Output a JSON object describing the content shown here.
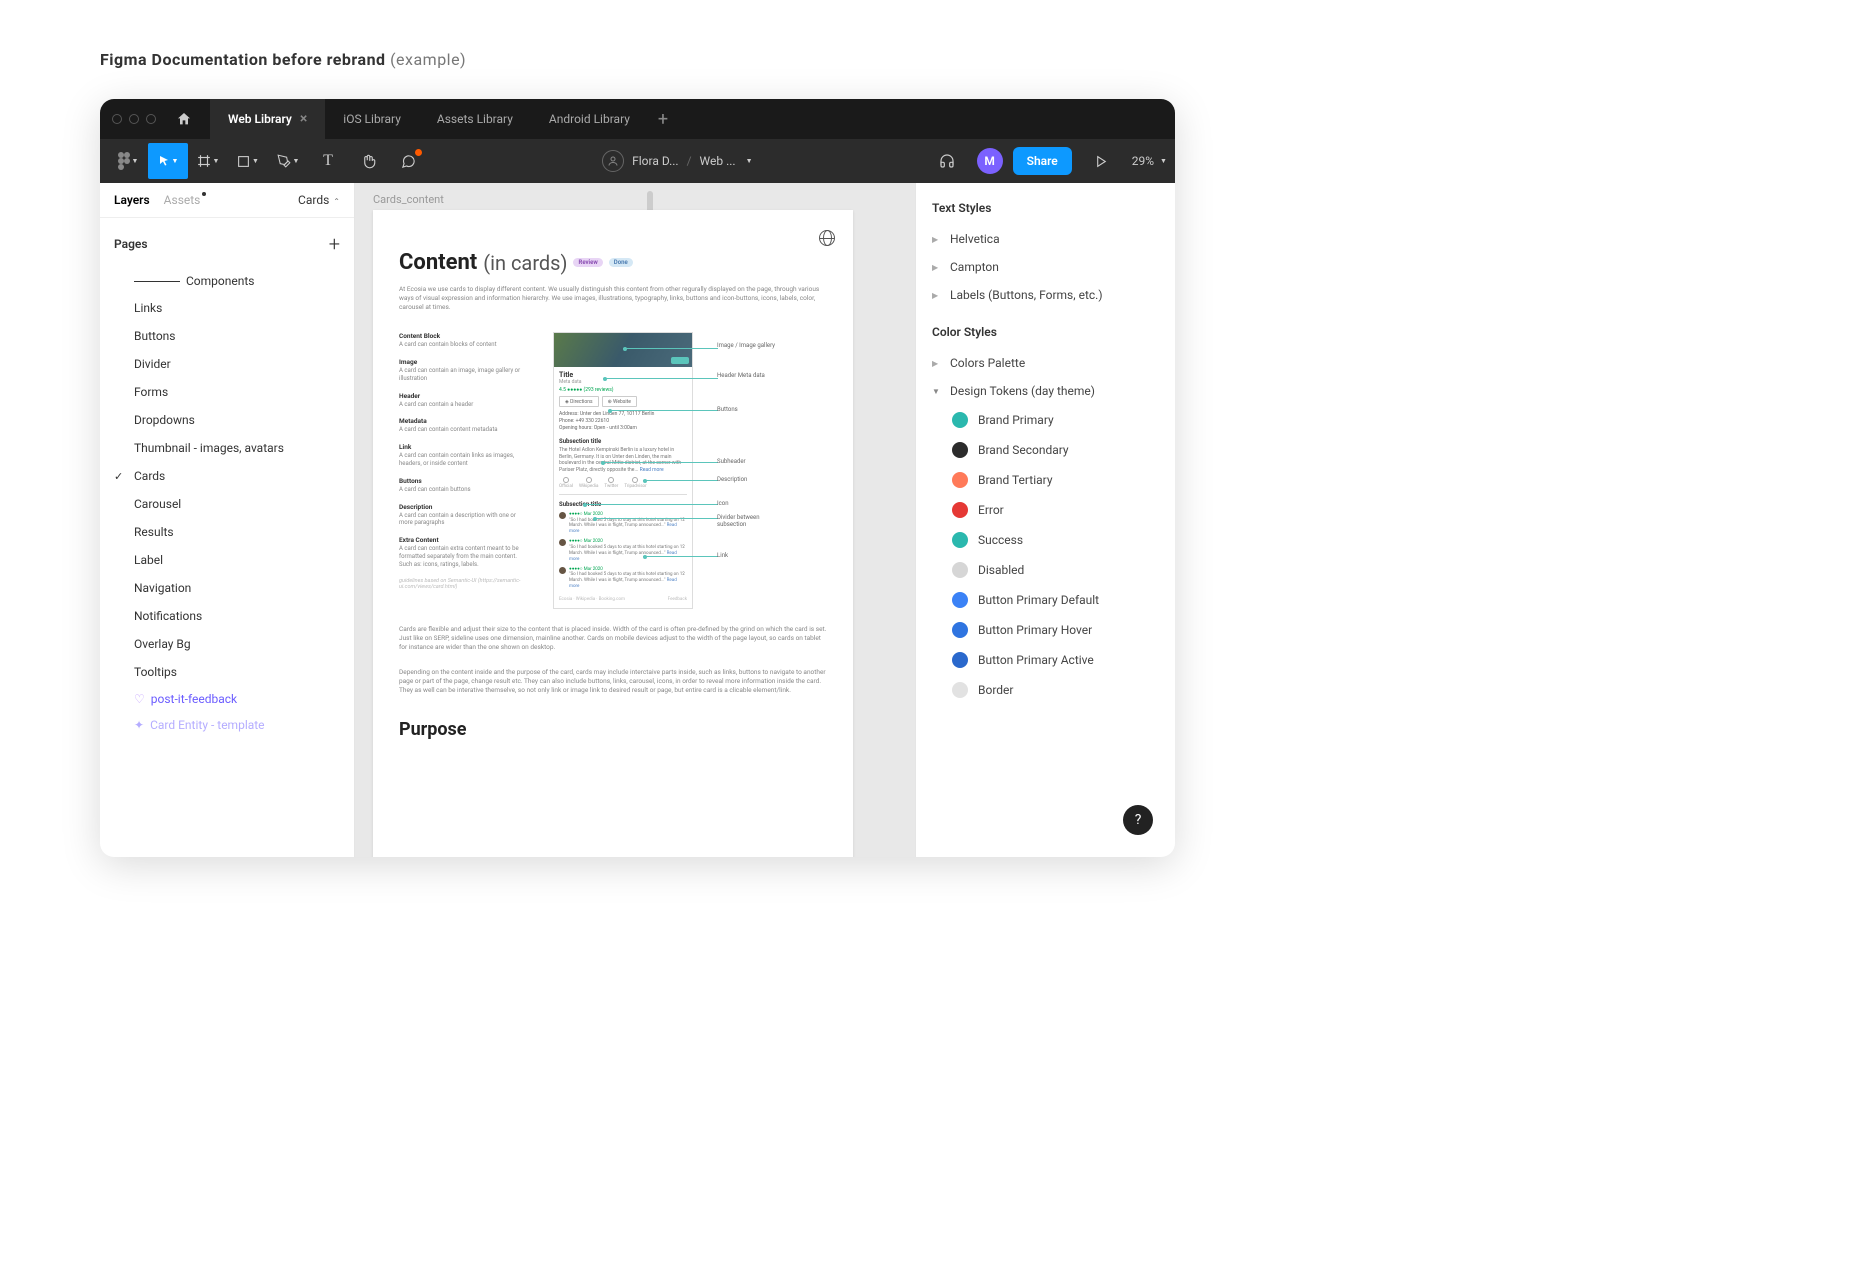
{
  "page_heading": "Figma Documentation before rebrand",
  "page_heading_suffix": "(example)",
  "tabs": [
    {
      "label": "Web Library",
      "active": true
    },
    {
      "label": "iOS Library"
    },
    {
      "label": "Assets Library"
    },
    {
      "label": "Android Library"
    }
  ],
  "breadcrumb": {
    "user": "Flora D...",
    "file": "Web ..."
  },
  "toolbar_right": {
    "avatar_initial": "M",
    "share": "Share",
    "zoom": "29%"
  },
  "left_panel": {
    "tabs": [
      "Layers",
      "Assets"
    ],
    "active_tab": "Layers",
    "dropdown": "Cards",
    "pages_label": "Pages",
    "divider_label": "Components",
    "pages": [
      "Links",
      "Buttons",
      "Divider",
      "Forms",
      "Dropdowns",
      "Thumbnail - images, avatars",
      "Cards",
      "Carousel",
      "Results",
      "Label",
      "Navigation",
      "Notifications",
      "Overlay Bg",
      "Tooltips"
    ],
    "selected_page": "Cards",
    "extras": [
      "post-it-feedback",
      "Card Entity - template"
    ]
  },
  "canvas": {
    "frame_label": "Cards_content",
    "h1": "Content",
    "h1_paren": "(in cards)",
    "pills": [
      "Review",
      "Done"
    ],
    "intro": "At Ecosia we use cards to display different content. We usually distinguish this content from other regurally displayed on the page, through various ways of visual expression and information hierarchy. We use images, illustrations, typography, links, buttons and icon-buttons, icons, labels, color, carousel at times.",
    "definitions": [
      {
        "h": "Content Block",
        "t": "A card can contain blocks of content"
      },
      {
        "h": "Image",
        "t": "A card can contain an image, image gallery or illustration"
      },
      {
        "h": "Header",
        "t": "A card can contain a header"
      },
      {
        "h": "Metadata",
        "t": "A card can contain content metadata"
      },
      {
        "h": "Link",
        "t": "A card can contain contain links as images, headers, or inside content"
      },
      {
        "h": "Buttons",
        "t": "A card can contain buttons"
      },
      {
        "h": "Description",
        "t": "A card can contain a description with one or more paragraphs"
      },
      {
        "h": "Extra Content",
        "t": "A card can contain extra content meant to be formatted separately from the main content. Such as: icons, ratings, labels."
      }
    ],
    "guideline_note": "guidelines based on Semantic-UI (https://semantic-ui.com/views/card.html)",
    "card_demo": {
      "title": "Title",
      "meta": "Meta data",
      "rating": "4.5 ●●●●● (293 reviews)",
      "btns": [
        "Directions",
        "Website"
      ],
      "address": "Address: Unter den Linden 77, 10117 Berlin",
      "phone": "Phone: +49 330 22610",
      "hours": "Opening hours: Open - until 3:00am",
      "sub1": "Subsection title",
      "desc": "The Hotel Adlon Kempinski Berlin is a luxury hotel in Berlin, Germany. It is on Unter den Linden, the main boulevard in the central Mitte district, at the corner with Pariser Platz, directly opposite the...",
      "read_more": "Read more",
      "icons": [
        "Official",
        "Wikipedia",
        "Twitter",
        "Tripadvisor"
      ],
      "sub2": "Subsection title",
      "review_rating": "●●●●○ Mar 2020",
      "review_text": "\"So I had booked 5 days to stay at this hotel starting on 12 March. While I was in flight, Trump announced...\"",
      "footer_l": "Ecosia · Wikipedia · Booking.com",
      "footer_r": "Feedback"
    },
    "annotations": [
      "Image / Image gallery",
      "Header Meta data",
      "Buttons",
      "Subheader",
      "Description",
      "Icon",
      "Divider between subsection",
      "Link"
    ],
    "para1": "Cards are flexible and adjust their size to the content that is placed inside. Width of the card is often pre-defined by the grind on which the card is set. Just like on SERP, sideline uses one dimension, mainline another. Cards on mobile devices adjust to the width of the page layout, so cards on tablet for instance are wider than the one shown on desktop.",
    "para2": "Depending on the content inside and the purpose of the card, cards may include interctaive parts inside, such as links, buttons to navigate to another page or part of the page, change result etc. They can also include buttons, links, carousel, icons, in order to reveal more information inside the card. They as well can be interative themselve, so not only link or image link to desired result or page, but entire card is a clicable element/link.",
    "purpose": "Purpose"
  },
  "right_panel": {
    "text_styles_h": "Text Styles",
    "text_styles": [
      "Helvetica",
      "Campton",
      "Labels (Buttons, Forms, etc.)"
    ],
    "color_styles_h": "Color Styles",
    "color_groups": [
      {
        "label": "Colors Palette",
        "open": false
      },
      {
        "label": "Design Tokens (day theme)",
        "open": true
      }
    ],
    "tokens": [
      {
        "label": "Brand Primary",
        "c": "#2bb8ae"
      },
      {
        "label": "Brand Secondary",
        "c": "#2c2c2c"
      },
      {
        "label": "Brand Tertiary",
        "c": "#ff7a59"
      },
      {
        "label": "Error",
        "c": "#e53935"
      },
      {
        "label": "Success",
        "c": "#2bb8ae"
      },
      {
        "label": "Disabled",
        "c": "#d6d6d6"
      },
      {
        "label": "Button Primary Default",
        "c": "#3b82f6"
      },
      {
        "label": "Button Primary Hover",
        "c": "#2f74e0"
      },
      {
        "label": "Button Primary Active",
        "c": "#2a68cc"
      },
      {
        "label": "Border",
        "c": "#e2e2e2"
      }
    ]
  },
  "help": "?"
}
